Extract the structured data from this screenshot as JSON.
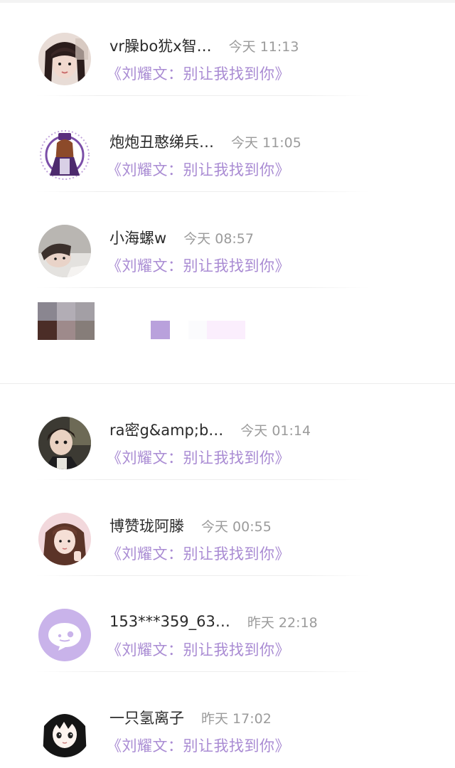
{
  "comments": [
    {
      "name": "vr臊bo犹x智…",
      "time": "今天 11:13",
      "message": "《刘耀文：别让我找到你》",
      "avatar": "girl-bangs-avatar"
    },
    {
      "name": "炮炮丑憨绨兵…",
      "time": "今天 11:05",
      "message": "《刘耀文：别让我找到你》",
      "avatar": "purple-illustration-avatar"
    },
    {
      "name": "小海螺w",
      "time": "今天 08:57",
      "message": "《刘耀文：别让我找到你》",
      "avatar": "lying-person-avatar"
    },
    {
      "name": "ra密g&amp;b…",
      "time": "今天 01:14",
      "message": "《刘耀文：别让我找到你》",
      "avatar": "child-dark-avatar"
    },
    {
      "name": "博赞珑阿滕",
      "time": "今天 00:55",
      "message": "《刘耀文：别让我找到你》",
      "avatar": "long-hair-girl-avatar"
    },
    {
      "name": "153***359_63…",
      "time": "昨天 22:18",
      "message": "《刘耀文：别让我找到你》",
      "avatar": "default-chat-avatar"
    },
    {
      "name": "一只氢离子",
      "time": "昨天 17:02",
      "message": "《刘耀文：别让我找到你》",
      "avatar": "anime-girl-avatar"
    }
  ],
  "colors": {
    "message": "#a98bd3",
    "default_avatar_bg": "#c9b3ea",
    "name": "#2a2a2a",
    "time": "#9b9b9b"
  }
}
